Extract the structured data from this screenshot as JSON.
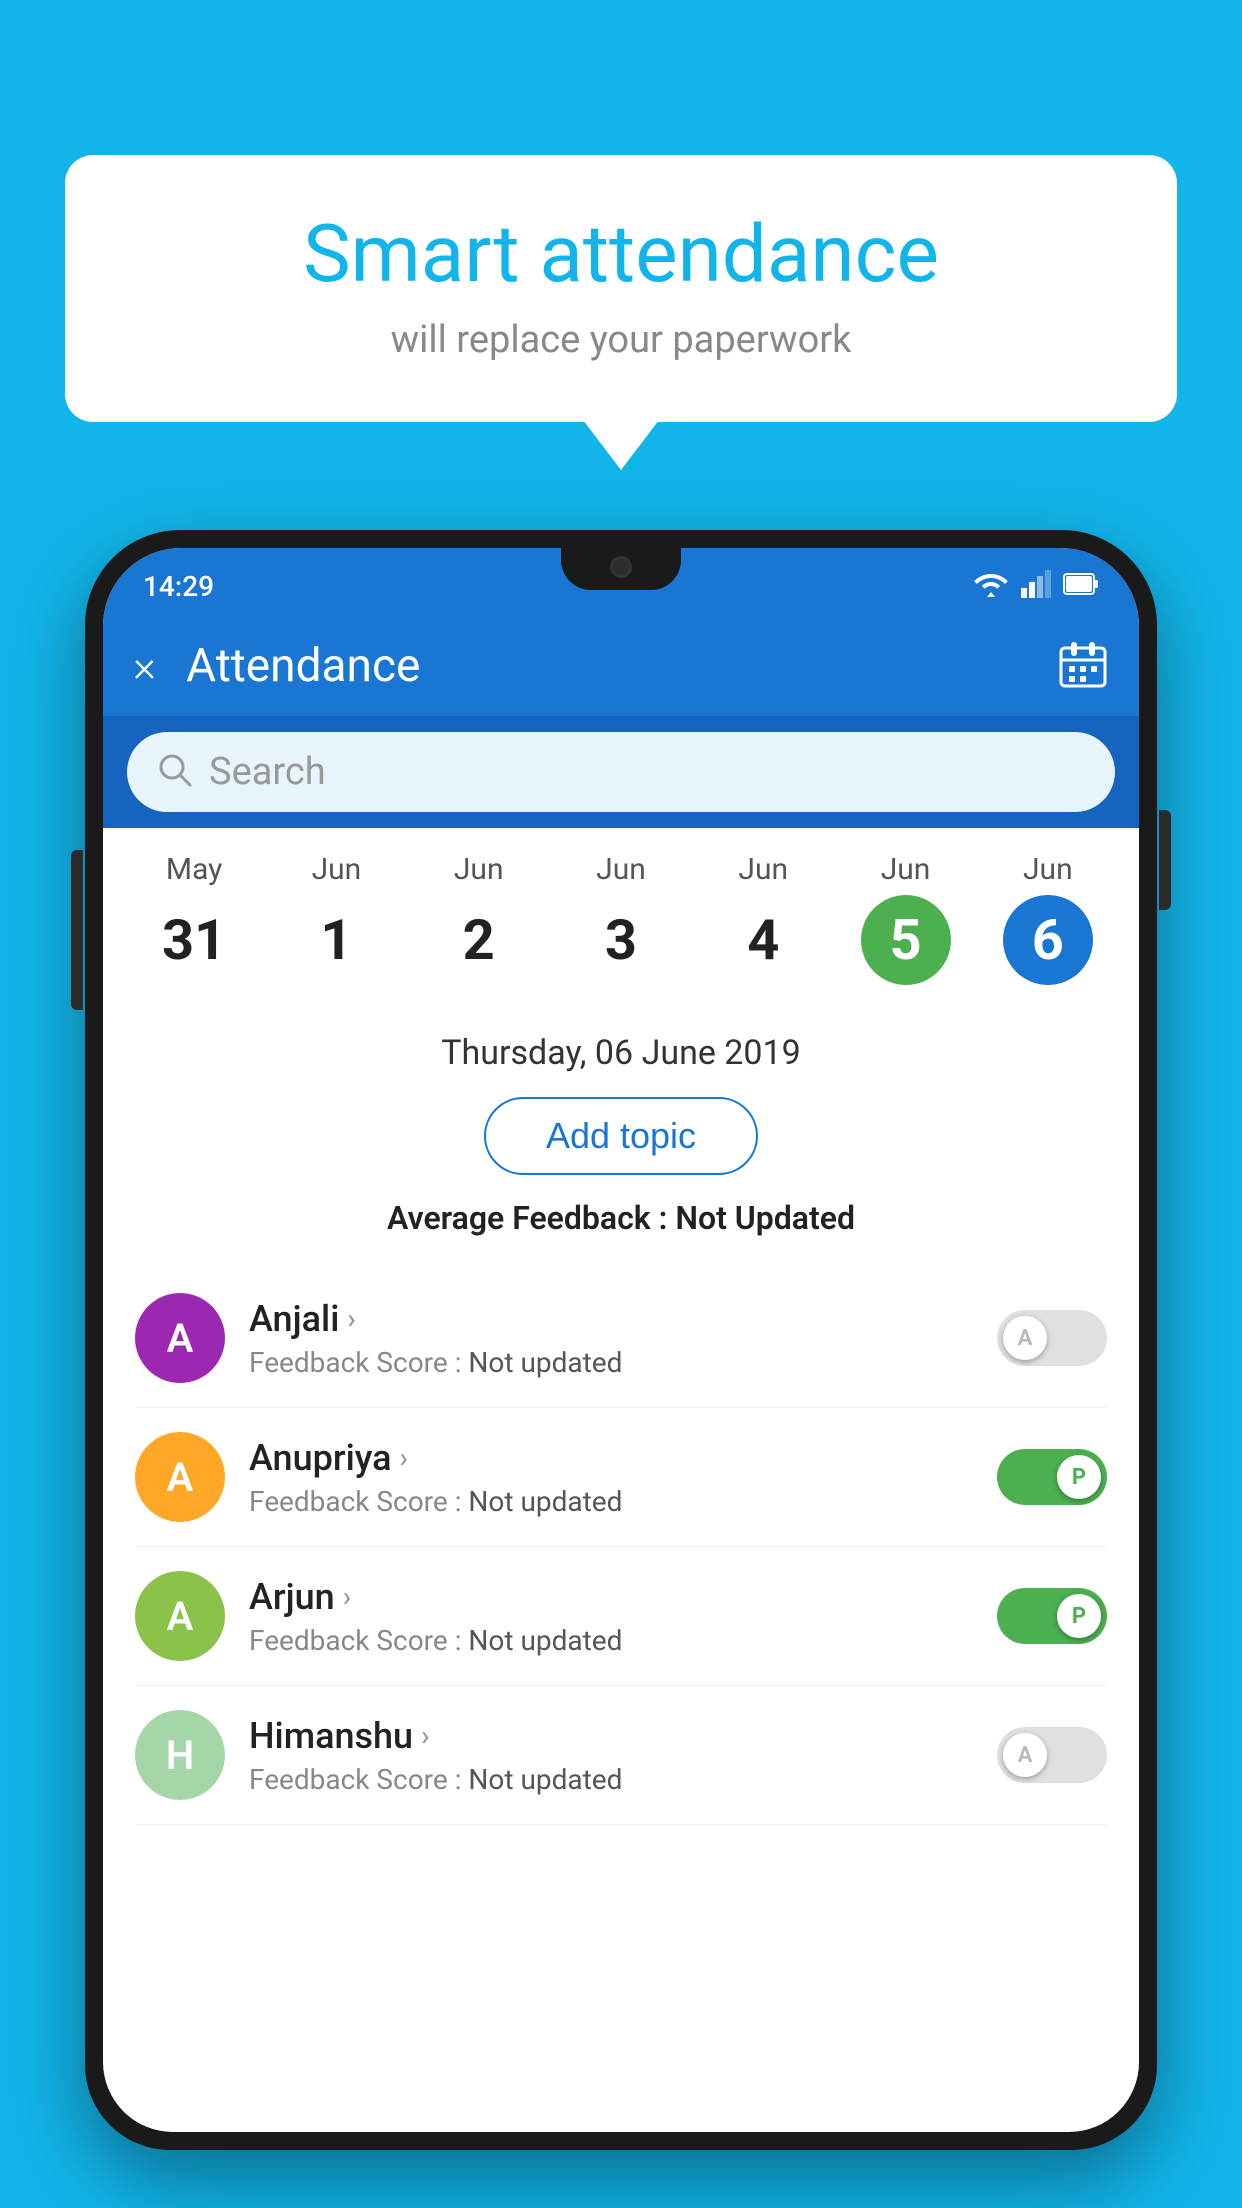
{
  "background_color": "#12B5EA",
  "speech_bubble": {
    "title": "Smart attendance",
    "subtitle": "will replace your paperwork"
  },
  "status_bar": {
    "time": "14:29",
    "wifi": "▼",
    "signal": "▲",
    "battery": "▮"
  },
  "app_bar": {
    "title": "Attendance",
    "close_label": "×",
    "calendar_icon": "calendar"
  },
  "search": {
    "placeholder": "Search"
  },
  "calendar": {
    "days": [
      {
        "month": "May",
        "date": "31",
        "style": ""
      },
      {
        "month": "Jun",
        "date": "1",
        "style": ""
      },
      {
        "month": "Jun",
        "date": "2",
        "style": ""
      },
      {
        "month": "Jun",
        "date": "3",
        "style": ""
      },
      {
        "month": "Jun",
        "date": "4",
        "style": ""
      },
      {
        "month": "Jun",
        "date": "5",
        "style": "today"
      },
      {
        "month": "Jun",
        "date": "6",
        "style": "selected"
      }
    ]
  },
  "selected_date": "Thursday, 06 June 2019",
  "add_topic_label": "Add topic",
  "avg_feedback_label": "Average Feedback : ",
  "avg_feedback_value": "Not Updated",
  "students": [
    {
      "name": "Anjali",
      "initial": "A",
      "avatar_color": "#9C27B0",
      "feedback_label": "Feedback Score : ",
      "feedback_value": "Not updated",
      "attendance": "absent"
    },
    {
      "name": "Anupriya",
      "initial": "A",
      "avatar_color": "#FFA726",
      "feedback_label": "Feedback Score : ",
      "feedback_value": "Not updated",
      "attendance": "present"
    },
    {
      "name": "Arjun",
      "initial": "A",
      "avatar_color": "#8BC34A",
      "feedback_label": "Feedback Score : ",
      "feedback_value": "Not updated",
      "attendance": "present"
    },
    {
      "name": "Himanshu",
      "initial": "H",
      "avatar_color": "#A5D6A7",
      "feedback_label": "Feedback Score : ",
      "feedback_value": "Not updated",
      "attendance": "absent"
    }
  ],
  "toggle_absent_label": "A",
  "toggle_present_label": "P"
}
